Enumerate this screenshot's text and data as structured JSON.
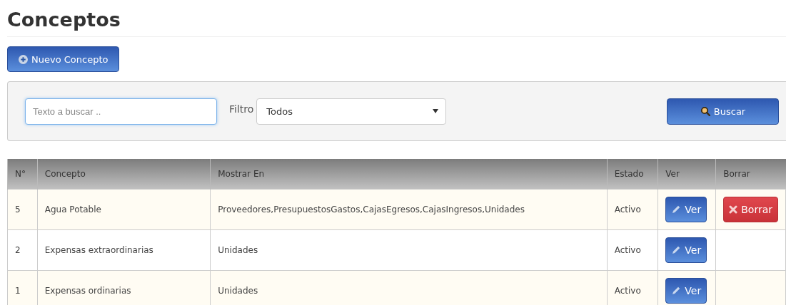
{
  "title": "Conceptos",
  "new_button": {
    "label": "Nuevo Concepto"
  },
  "search": {
    "placeholder": "Texto a buscar ..",
    "filter_label": "Filtro",
    "filter_value": "Todos",
    "button": "Buscar"
  },
  "table": {
    "columns": [
      "N°",
      "Concepto",
      "Mostrar En",
      "Estado",
      "Ver",
      "Borrar"
    ],
    "rows": [
      {
        "number": "5",
        "concept": "Agua Potable",
        "show_in": "Proveedores,PresupuestosGastos,CajasEgresos,CajasIngresos,Unidades",
        "status": "Activo",
        "view_button": "Ver",
        "delete_button": "Borrar"
      },
      {
        "number": "2",
        "concept": "Expensas extraordinarias",
        "show_in": "Unidades",
        "status": "Activo",
        "view_button": "Ver"
      },
      {
        "number": "1",
        "concept": "Expensas ordinarias",
        "show_in": "Unidades",
        "status": "Activo",
        "view_button": "Ver"
      }
    ]
  }
}
